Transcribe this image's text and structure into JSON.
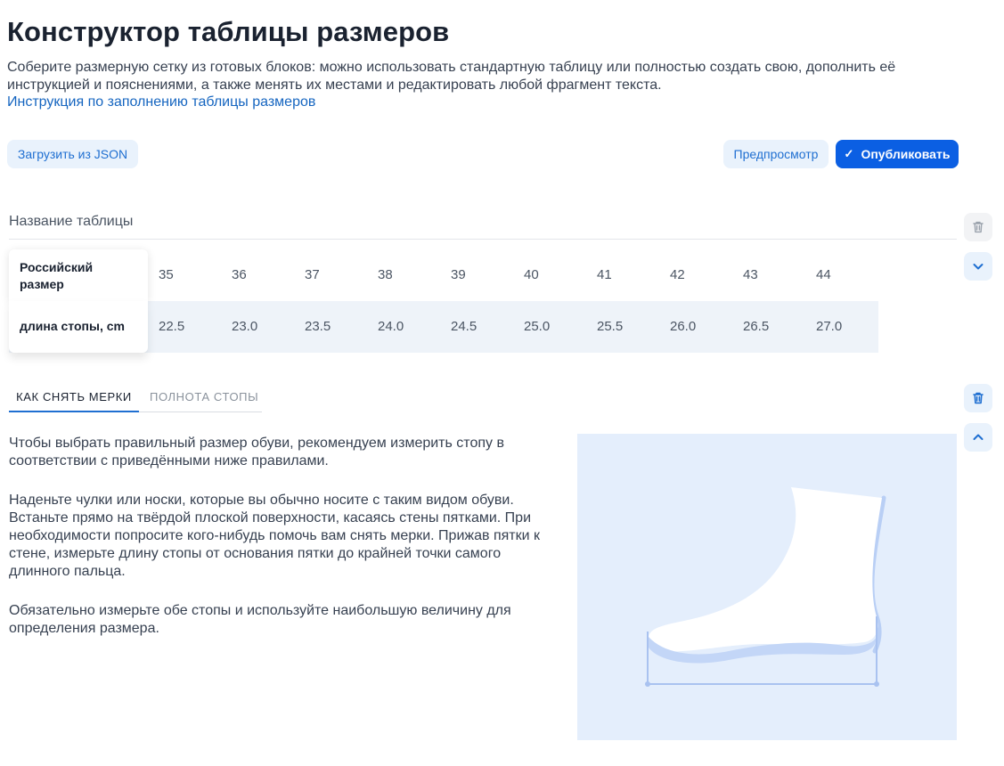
{
  "page": {
    "title": "Конструктор таблицы размеров",
    "description": "Соберите размерную сетку из готовых блоков: можно использовать стандартную таблицу или полностью создать свою, дополнить её инструкцией и пояснениями, а также менять их местами и редактировать любой фрагмент текста.",
    "instruction_link": "Инструкция по заполнению таблицы размеров"
  },
  "toolbar": {
    "load_json": "Загрузить из JSON",
    "preview": "Предпросмотр",
    "publish": "Опубликовать"
  },
  "table_block": {
    "name_placeholder": "Название таблицы",
    "rows": [
      {
        "header": "Российский размер",
        "values": [
          "35",
          "36",
          "37",
          "38",
          "39",
          "40",
          "41",
          "42",
          "43",
          "44"
        ]
      },
      {
        "header": "длина стопы,  cm",
        "values": [
          "22.5",
          "23.0",
          "23.5",
          "24.0",
          "24.5",
          "25.0",
          "25.5",
          "26.0",
          "26.5",
          "27.0"
        ]
      }
    ]
  },
  "instruction_block": {
    "tabs": [
      "КАК СНЯТЬ МЕРКИ",
      "ПОЛНОТА СТОПЫ"
    ],
    "active_tab": 0,
    "paragraphs": [
      "Чтобы выбрать правильный размер обуви, рекомендуем измерить стопу в соответствии с приведёнными ниже правилами.",
      "Наденьте чулки или носки, которые вы обычно носите с таким видом обуви. Встаньте прямо на твёрдой плоской поверхности, касаясь стены пятками. При необходимости попросите кого-нибудь помочь вам снять мерки. Прижав пятки к стене, измерьте длину стопы от основания пятки до крайней точки самого длинного пальца.",
      "Обязательно измерьте обе стопы и используйте наибольшую величину для определения размера."
    ]
  },
  "icons": {
    "delete_table": "trash-icon",
    "collapse_table": "chevron-down-icon",
    "delete_instruction": "trash-icon",
    "expand_instruction": "chevron-up-icon",
    "publish": "check-icon",
    "illustration": "foot-measure-illustration"
  },
  "colors": {
    "primary": "#0b5fe3",
    "link": "#1565c0",
    "light_button": "#e9f2fc",
    "table_row_alt": "#eef3f9",
    "illustration_bg": "#e4eefc"
  }
}
